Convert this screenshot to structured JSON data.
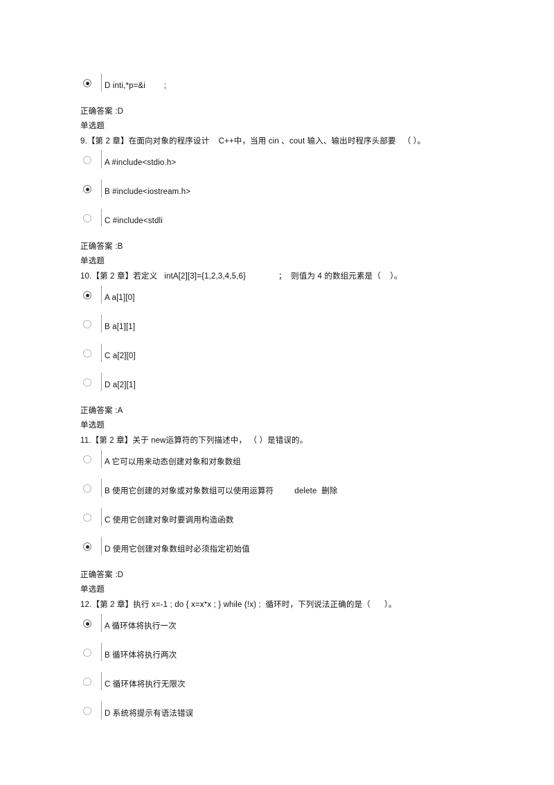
{
  "document": {
    "type": "exam-answer-sheet",
    "language": "zh-CN",
    "labels": {
      "correct_answer_prefix": "正确答案 :",
      "question_type_single": "单选题"
    }
  },
  "leading_option": {
    "label": "D inti,*p=&i        ;",
    "selected": true
  },
  "leading_answer": "正确答案 :D",
  "leading_type": "单选题",
  "questions": [
    {
      "number": "9.",
      "stem": "9.【第 2 章】在面向对象的程序设计    C++中，当用 cin 、cout 输入、输出时程序头部要   （ ）。",
      "options": [
        {
          "label": "A #include<stdio.h>",
          "selected": false
        },
        {
          "label": "B #include<iostream.h>",
          "selected": true
        },
        {
          "label": "C #include<stdli",
          "selected": false
        }
      ],
      "answer_line": "正确答案 :B",
      "type_line": "单选题"
    },
    {
      "number": "10.",
      "stem": "10.【第 2 章】若定义   intA[2][3]={1,2,3,4,5,6}              ；  则值为 4 的数组元素是（    ）。",
      "options": [
        {
          "label": "A a[1][0]",
          "selected": true
        },
        {
          "label": "B a[1][1]",
          "selected": false
        },
        {
          "label": "C a[2][0]",
          "selected": false
        },
        {
          "label": "D a[2][1]",
          "selected": false
        }
      ],
      "answer_line": "正确答案 :A",
      "type_line": "单选题"
    },
    {
      "number": "11.",
      "stem": "11.【第 2 章】关于 new运算符的下列描述中， （ ）是错误的。",
      "options": [
        {
          "label": "A 它可以用来动态创建对象和对象数组",
          "selected": false
        },
        {
          "label": "B 使用它创建的对象或对象数组可以使用运算符         delete  删除",
          "selected": false
        },
        {
          "label": "C 使用它创建对象时要调用构造函数",
          "selected": false
        },
        {
          "label": "D 使用它创建对象数组时必须指定初始值",
          "selected": true
        }
      ],
      "answer_line": "正确答案 :D",
      "type_line": "单选题"
    },
    {
      "number": "12.",
      "stem": "12.【第 2 章】执行 x=-1 ; do { x=x*x ; } while (!x) ;  循环时，下列说法正确的是（      ）。",
      "options": [
        {
          "label": "A 循环体将执行一次",
          "selected": true
        },
        {
          "label": "B 循环体将执行两次",
          "selected": false
        },
        {
          "label": "C 循环体将执行无限次",
          "selected": false
        },
        {
          "label": "D 系统将提示有语法错误",
          "selected": false
        }
      ],
      "answer_line": "",
      "type_line": ""
    }
  ]
}
